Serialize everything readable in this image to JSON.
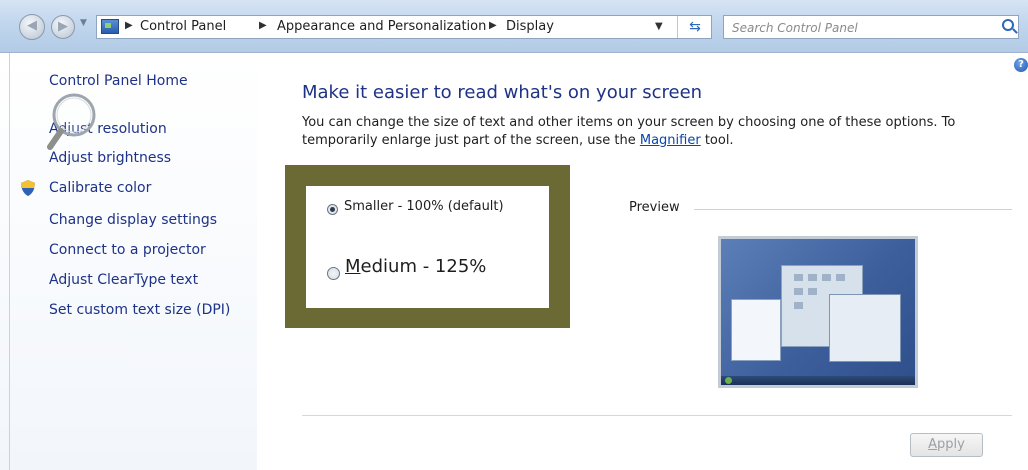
{
  "addressbar": {
    "crumbs": [
      "Control Panel",
      "Appearance and Personalization",
      "Display"
    ],
    "search_placeholder": "Search Control Panel",
    "back_glyph": "◀",
    "forward_glyph": "▶",
    "refresh_glyph": "⇆"
  },
  "sidebar": {
    "items": [
      {
        "label": "Control Panel Home"
      },
      {
        "label": "Adjust resolution"
      },
      {
        "label": "Adjust brightness"
      },
      {
        "label": "Calibrate color",
        "icon": "shield-icon"
      },
      {
        "label": "Change display settings"
      },
      {
        "label": "Connect to a projector"
      },
      {
        "label": "Adjust ClearType text"
      },
      {
        "label": "Set custom text size (DPI)"
      }
    ]
  },
  "main": {
    "heading": "Make it easier to read what's on your screen",
    "desc_before": "You can change the size of text and other items on your screen by choosing one of these options. To temporarily enlarge just part of the screen, use the ",
    "desc_link": "Magnifier",
    "desc_after": " tool.",
    "options": [
      {
        "label": "Smaller - 100% (default)",
        "selected": true
      },
      {
        "label_underlined": "M",
        "label_rest": "edium - 125%",
        "selected": false
      }
    ],
    "preview_label": "Preview",
    "apply_underlined": "A",
    "apply_rest": "pply",
    "help_glyph": "?"
  },
  "colors": {
    "highlight_box": "#6b6a35",
    "link_blue": "#1e3287",
    "heading_blue": "#1e3287"
  }
}
